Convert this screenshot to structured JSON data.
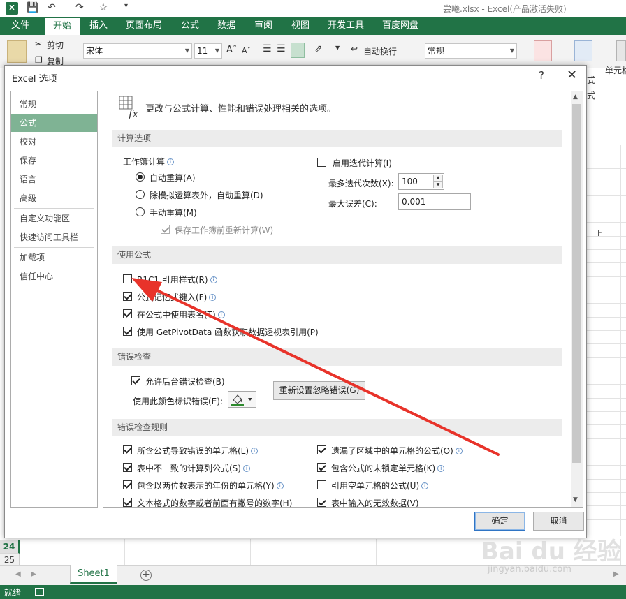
{
  "window": {
    "file_title": "尝曦.xlsx - Excel(产品激活失败)"
  },
  "ribbon": {
    "tabs": [
      "文件",
      "开始",
      "插入",
      "页面布局",
      "公式",
      "数据",
      "审阅",
      "视图",
      "开发工具",
      "百度网盘"
    ],
    "active_tab": "开始",
    "cut_label": "剪切",
    "copy_label": "复制",
    "font_name": "宋体",
    "font_size": "11",
    "wrap_text_label": "自动换行",
    "number_format": "常规",
    "cell_styles_label": "单元格",
    "partial_label": "式"
  },
  "sheet": {
    "column_f": "F",
    "rows": [
      "24",
      "25"
    ],
    "tab_name": "Sheet1",
    "add_sheet": "+",
    "status": "就绪"
  },
  "dialog": {
    "title": "Excel 选项",
    "help": "?",
    "close": "✕",
    "nav": [
      "常规",
      "公式",
      "校对",
      "保存",
      "语言",
      "高级",
      "自定义功能区",
      "快速访问工具栏",
      "加载项",
      "信任中心"
    ],
    "selected_nav": "公式",
    "header": "更改与公式计算、性能和错误处理相关的选项。",
    "sections": {
      "calc": "计算选项",
      "formulas": "使用公式",
      "error_check": "错误检查",
      "error_rules": "错误检查规则"
    },
    "calc": {
      "workbook_calc": "工作簿计算",
      "auto": "自动重算(A)",
      "auto_except_tables": "除模拟运算表外，自动重算(D)",
      "manual": "手动重算(M)",
      "recalc_before_save": "保存工作簿前重新计算(W)",
      "enable_iterative": "启用迭代计算(I)",
      "max_iterations_label": "最多迭代次数(X):",
      "max_iterations_value": "100",
      "max_change_label": "最大误差(C):",
      "max_change_value": "0.001"
    },
    "formulas": {
      "r1c1": "R1C1 引用样式(R)",
      "autocomplete": "公式记忆式键入(F)",
      "table_names": "在公式中使用表名(T)",
      "getpivotdata": "使用 GetPivotData 函数获取数据透视表引用(P)"
    },
    "error_check": {
      "enable_background": "允许后台错误检查(B)",
      "color_label": "使用此颜色标识错误(E):",
      "reset_button": "重新设置忽略错误(G)"
    },
    "error_rules": {
      "left": [
        "所含公式导致错误的单元格(L)",
        "表中不一致的计算列公式(S)",
        "包含以两位数表示的年份的单元格(Y)",
        "文本格式的数字或者前面有撇号的数字(H)"
      ],
      "right": [
        "遗漏了区域中的单元格的公式(O)",
        "包含公式的未锁定单元格(K)",
        "引用空单元格的公式(U)",
        "表中输入的无效数据(V)"
      ]
    },
    "ok": "确定",
    "cancel": "取消"
  },
  "watermark": {
    "top": "Bai du 经验",
    "bottom": "jingyan.baidu.com"
  },
  "colors": {
    "excel_green": "#217346",
    "nav_selected": "#7fb394",
    "arrow_red": "#e8332a"
  }
}
